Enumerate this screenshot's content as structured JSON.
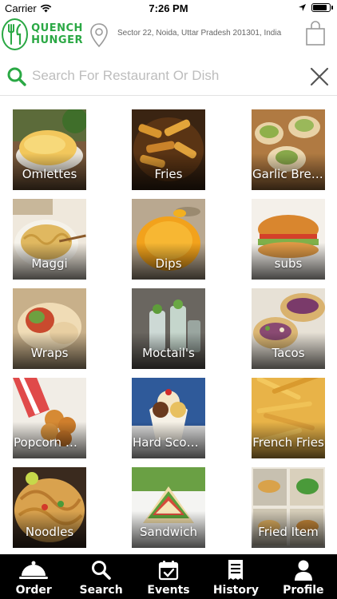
{
  "status_bar": {
    "carrier": "Carrier",
    "time": "7:26 PM",
    "battery_level": 0.85
  },
  "header": {
    "logo_line1": "QUENCH",
    "logo_line2": "HUNGER",
    "address": "Sector 22, Noida, Uttar Pradesh 201301, India",
    "icons": [
      "location-pin-icon",
      "shopping-bag-icon"
    ],
    "accent_color": "#2aa844"
  },
  "search": {
    "placeholder": "Search For Restaurant Or Dish",
    "value": ""
  },
  "categories": [
    {
      "label": "Omlettes"
    },
    {
      "label": "Fries"
    },
    {
      "label": "Garlic Breads"
    },
    {
      "label": "Maggi"
    },
    {
      "label": "Dips"
    },
    {
      "label": "subs"
    },
    {
      "label": "Wraps"
    },
    {
      "label": "Moctail's"
    },
    {
      "label": "Tacos"
    },
    {
      "label": "Popcorn Nu..."
    },
    {
      "label": "Hard Scoop..."
    },
    {
      "label": "French Fries"
    },
    {
      "label": "Noodles"
    },
    {
      "label": "Sandwich"
    },
    {
      "label": "Fried Item"
    }
  ],
  "tabs": [
    {
      "label": "Order",
      "icon": "cloche-icon"
    },
    {
      "label": "Search",
      "icon": "search-icon"
    },
    {
      "label": "Events",
      "icon": "calendar-icon"
    },
    {
      "label": "History",
      "icon": "receipt-icon"
    },
    {
      "label": "Profile",
      "icon": "user-icon"
    }
  ]
}
